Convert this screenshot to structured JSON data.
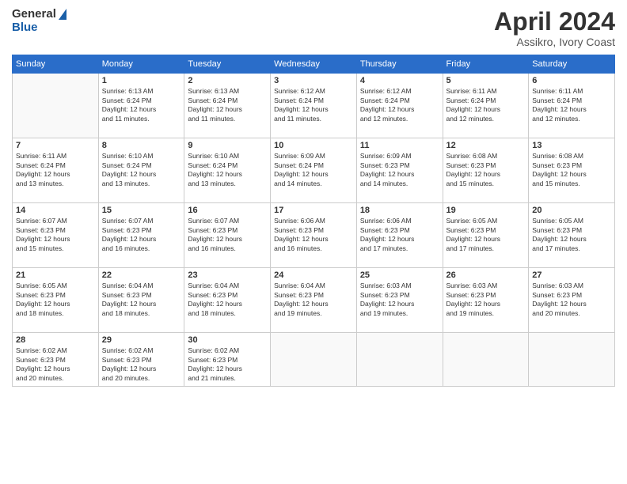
{
  "header": {
    "logo_line1": "General",
    "logo_line2": "Blue",
    "month": "April 2024",
    "location": "Assikro, Ivory Coast"
  },
  "days_of_week": [
    "Sunday",
    "Monday",
    "Tuesday",
    "Wednesday",
    "Thursday",
    "Friday",
    "Saturday"
  ],
  "weeks": [
    [
      {
        "day": "",
        "info": ""
      },
      {
        "day": "1",
        "info": "Sunrise: 6:13 AM\nSunset: 6:24 PM\nDaylight: 12 hours\nand 11 minutes."
      },
      {
        "day": "2",
        "info": "Sunrise: 6:13 AM\nSunset: 6:24 PM\nDaylight: 12 hours\nand 11 minutes."
      },
      {
        "day": "3",
        "info": "Sunrise: 6:12 AM\nSunset: 6:24 PM\nDaylight: 12 hours\nand 11 minutes."
      },
      {
        "day": "4",
        "info": "Sunrise: 6:12 AM\nSunset: 6:24 PM\nDaylight: 12 hours\nand 12 minutes."
      },
      {
        "day": "5",
        "info": "Sunrise: 6:11 AM\nSunset: 6:24 PM\nDaylight: 12 hours\nand 12 minutes."
      },
      {
        "day": "6",
        "info": "Sunrise: 6:11 AM\nSunset: 6:24 PM\nDaylight: 12 hours\nand 12 minutes."
      }
    ],
    [
      {
        "day": "7",
        "info": "Sunrise: 6:11 AM\nSunset: 6:24 PM\nDaylight: 12 hours\nand 13 minutes."
      },
      {
        "day": "8",
        "info": "Sunrise: 6:10 AM\nSunset: 6:24 PM\nDaylight: 12 hours\nand 13 minutes."
      },
      {
        "day": "9",
        "info": "Sunrise: 6:10 AM\nSunset: 6:24 PM\nDaylight: 12 hours\nand 13 minutes."
      },
      {
        "day": "10",
        "info": "Sunrise: 6:09 AM\nSunset: 6:24 PM\nDaylight: 12 hours\nand 14 minutes."
      },
      {
        "day": "11",
        "info": "Sunrise: 6:09 AM\nSunset: 6:23 PM\nDaylight: 12 hours\nand 14 minutes."
      },
      {
        "day": "12",
        "info": "Sunrise: 6:08 AM\nSunset: 6:23 PM\nDaylight: 12 hours\nand 15 minutes."
      },
      {
        "day": "13",
        "info": "Sunrise: 6:08 AM\nSunset: 6:23 PM\nDaylight: 12 hours\nand 15 minutes."
      }
    ],
    [
      {
        "day": "14",
        "info": "Sunrise: 6:07 AM\nSunset: 6:23 PM\nDaylight: 12 hours\nand 15 minutes."
      },
      {
        "day": "15",
        "info": "Sunrise: 6:07 AM\nSunset: 6:23 PM\nDaylight: 12 hours\nand 16 minutes."
      },
      {
        "day": "16",
        "info": "Sunrise: 6:07 AM\nSunset: 6:23 PM\nDaylight: 12 hours\nand 16 minutes."
      },
      {
        "day": "17",
        "info": "Sunrise: 6:06 AM\nSunset: 6:23 PM\nDaylight: 12 hours\nand 16 minutes."
      },
      {
        "day": "18",
        "info": "Sunrise: 6:06 AM\nSunset: 6:23 PM\nDaylight: 12 hours\nand 17 minutes."
      },
      {
        "day": "19",
        "info": "Sunrise: 6:05 AM\nSunset: 6:23 PM\nDaylight: 12 hours\nand 17 minutes."
      },
      {
        "day": "20",
        "info": "Sunrise: 6:05 AM\nSunset: 6:23 PM\nDaylight: 12 hours\nand 17 minutes."
      }
    ],
    [
      {
        "day": "21",
        "info": "Sunrise: 6:05 AM\nSunset: 6:23 PM\nDaylight: 12 hours\nand 18 minutes."
      },
      {
        "day": "22",
        "info": "Sunrise: 6:04 AM\nSunset: 6:23 PM\nDaylight: 12 hours\nand 18 minutes."
      },
      {
        "day": "23",
        "info": "Sunrise: 6:04 AM\nSunset: 6:23 PM\nDaylight: 12 hours\nand 18 minutes."
      },
      {
        "day": "24",
        "info": "Sunrise: 6:04 AM\nSunset: 6:23 PM\nDaylight: 12 hours\nand 19 minutes."
      },
      {
        "day": "25",
        "info": "Sunrise: 6:03 AM\nSunset: 6:23 PM\nDaylight: 12 hours\nand 19 minutes."
      },
      {
        "day": "26",
        "info": "Sunrise: 6:03 AM\nSunset: 6:23 PM\nDaylight: 12 hours\nand 19 minutes."
      },
      {
        "day": "27",
        "info": "Sunrise: 6:03 AM\nSunset: 6:23 PM\nDaylight: 12 hours\nand 20 minutes."
      }
    ],
    [
      {
        "day": "28",
        "info": "Sunrise: 6:02 AM\nSunset: 6:23 PM\nDaylight: 12 hours\nand 20 minutes."
      },
      {
        "day": "29",
        "info": "Sunrise: 6:02 AM\nSunset: 6:23 PM\nDaylight: 12 hours\nand 20 minutes."
      },
      {
        "day": "30",
        "info": "Sunrise: 6:02 AM\nSunset: 6:23 PM\nDaylight: 12 hours\nand 21 minutes."
      },
      {
        "day": "",
        "info": ""
      },
      {
        "day": "",
        "info": ""
      },
      {
        "day": "",
        "info": ""
      },
      {
        "day": "",
        "info": ""
      }
    ]
  ]
}
